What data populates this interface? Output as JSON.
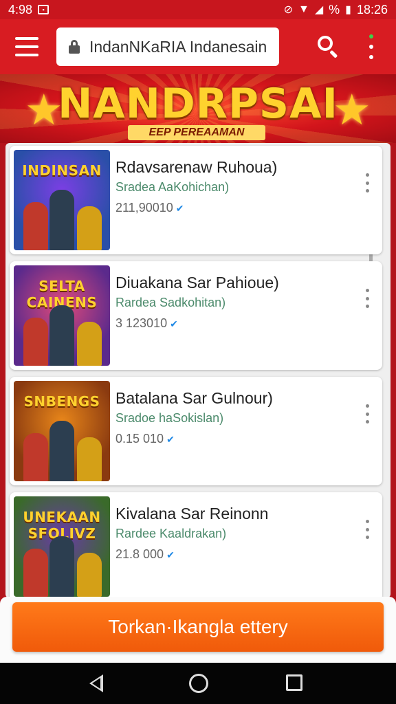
{
  "status_bar": {
    "time_left": "4:98",
    "time_right": "18:26",
    "percent_label": "%"
  },
  "app_bar": {
    "url_text": "IndanNKaRIA Indanesain"
  },
  "banner": {
    "title": "NANDRPSAI",
    "subtitle": "EEP PEREAAMAN"
  },
  "list": {
    "items": [
      {
        "title": "Rdavsarenaw Ruhoua)",
        "subtitle": "Sradea AaKohichan)",
        "count": "211,90010",
        "thumb_title": "INDINSAN",
        "thumb_bg": "#2a4fa8",
        "thumb_accent": "#7b3fe4"
      },
      {
        "title": "Diuakana Sar Pahioue)",
        "subtitle": "Rardea Sadkohitan)",
        "count": "3 123010",
        "thumb_title": "SELTA CAINENS",
        "thumb_bg": "#5b2a8c",
        "thumb_accent": "#e04a7a"
      },
      {
        "title": "Batalana Sar Gulnour)",
        "subtitle": "Sradoe haSokislan)",
        "count": "0.15 010",
        "thumb_title": "SNBENGS",
        "thumb_bg": "#8a3a10",
        "thumb_accent": "#e8861a"
      },
      {
        "title": "Kivalana Sar Reinonn",
        "subtitle": "Rardee Kaaldrakan)",
        "count": "21.8 000",
        "thumb_title": "UNEKAAN SFOLIVZ",
        "thumb_bg": "#3a6a2a",
        "thumb_accent": "#6a3aa8"
      }
    ]
  },
  "cta": {
    "label": "Torkan·Ikangla ettery"
  },
  "colors": {
    "brand_red": "#d81c22",
    "cta_orange": "#f26a10",
    "verified_blue": "#1e88e5"
  }
}
